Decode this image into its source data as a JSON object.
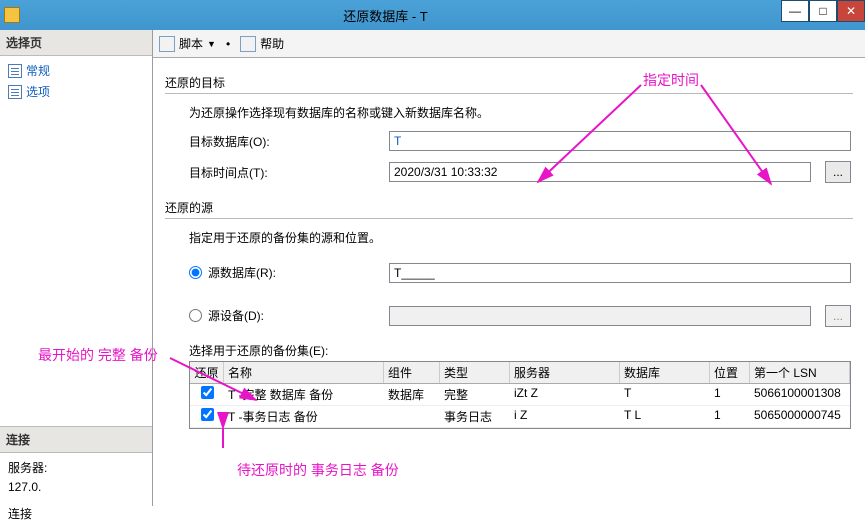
{
  "window": {
    "title": "还原数据库 - T"
  },
  "sidebar": {
    "header": "选择页",
    "items": [
      "常规",
      "选项"
    ],
    "conn_header": "连接",
    "conn_server_label": "服务器:",
    "conn_server_value": "127.0.",
    "conn_label": "连接"
  },
  "toolbar": {
    "script": "脚本",
    "help": "帮助"
  },
  "target": {
    "section": "还原的目标",
    "desc": "为还原操作选择现有数据库的名称或键入新数据库名称。",
    "db_label": "目标数据库(O):",
    "db_value": "T",
    "time_label": "目标时间点(T):",
    "time_value": "2020/3/31 10:33:32"
  },
  "source": {
    "section": "还原的源",
    "desc": "指定用于还原的备份集的源和位置。",
    "radio_db": "源数据库(R):",
    "radio_db_value": "T_____",
    "radio_dev": "源设备(D):",
    "grid_label": "选择用于还原的备份集(E):"
  },
  "grid": {
    "headers": [
      "还原",
      "名称",
      "组件",
      "类型",
      "服务器",
      "数据库",
      "位置",
      "第一个 LSN"
    ],
    "rows": [
      {
        "checked": true,
        "name": "T       -完整 数据库 备份",
        "comp": "数据库",
        "type": "完整",
        "server": "iZt           Z",
        "db": "T",
        "pos": "1",
        "lsn": "5066100001308"
      },
      {
        "checked": true,
        "name": "T       -事务日志 备份",
        "comp": "",
        "type": "事务日志",
        "server": "i              Z",
        "db": "T   L",
        "pos": "1",
        "lsn": "5065000000745"
      }
    ]
  },
  "annotations": {
    "time": "指定时间",
    "full": "最开始的 完整 备份",
    "log": "待还原时的 事务日志 备份"
  },
  "misc": {
    "ellipsis": "..."
  }
}
